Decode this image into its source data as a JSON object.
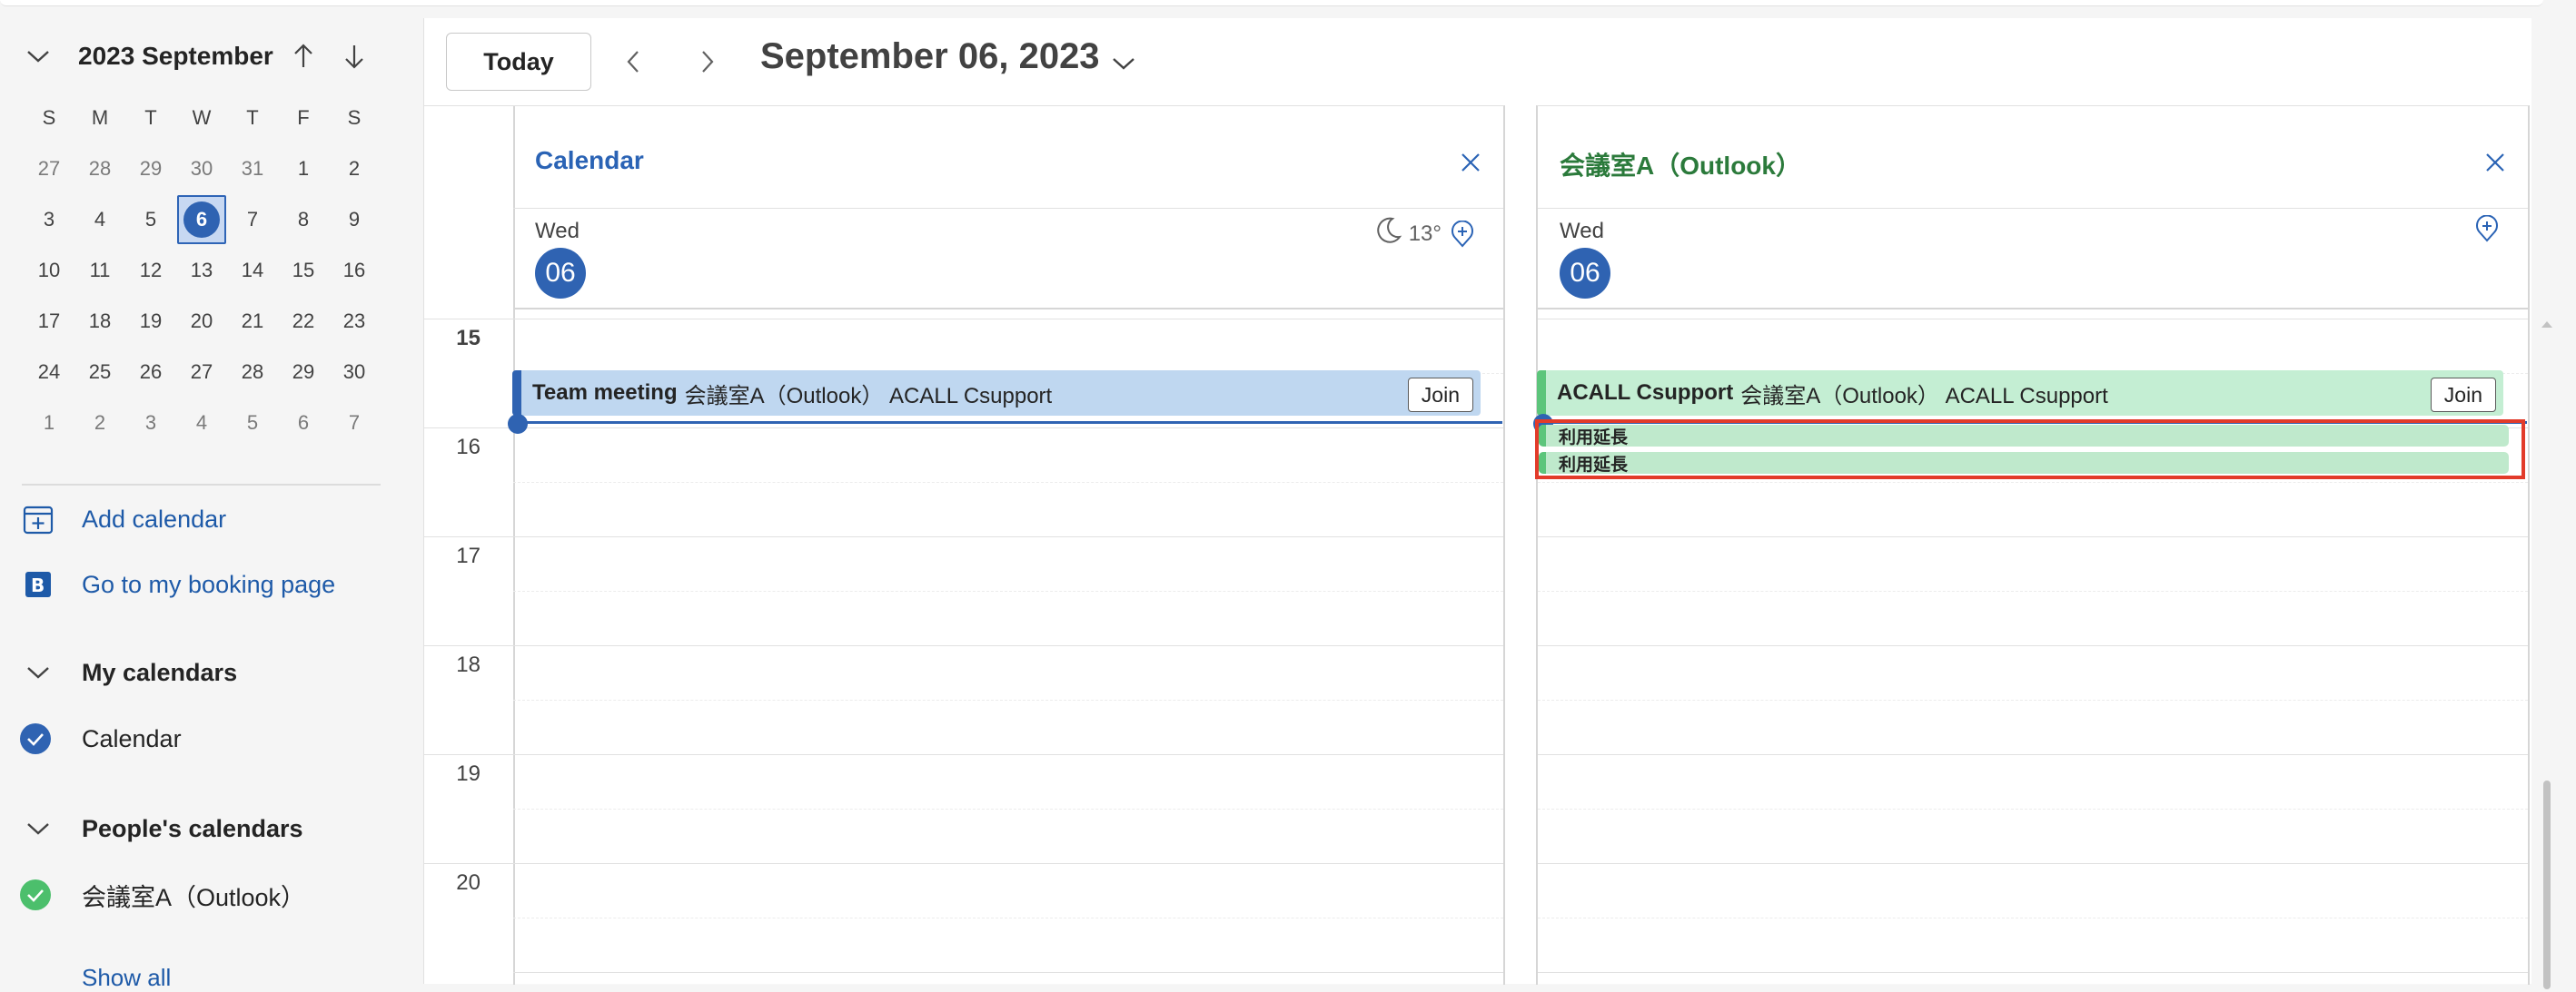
{
  "minical": {
    "month_title": "2023 September",
    "weekdays": [
      "S",
      "M",
      "T",
      "W",
      "T",
      "F",
      "S"
    ],
    "weeks": [
      [
        "27",
        "28",
        "29",
        "30",
        "31",
        "1",
        "2"
      ],
      [
        "3",
        "4",
        "5",
        "6",
        "7",
        "8",
        "9"
      ],
      [
        "10",
        "11",
        "12",
        "13",
        "14",
        "15",
        "16"
      ],
      [
        "17",
        "18",
        "19",
        "20",
        "21",
        "22",
        "23"
      ],
      [
        "24",
        "25",
        "26",
        "27",
        "28",
        "29",
        "30"
      ],
      [
        "1",
        "2",
        "3",
        "4",
        "5",
        "6",
        "7"
      ]
    ],
    "selected_day": "6"
  },
  "sidebar": {
    "add_calendar": "Add calendar",
    "booking_page": "Go to my booking page",
    "my_calendars": "My calendars",
    "my_calendar_item": "Calendar",
    "peoples_calendars": "People's calendars",
    "people_item": "会議室A（Outlook）",
    "show_all": "Show all"
  },
  "toolbar": {
    "today": "Today",
    "date_title": "September 06, 2023"
  },
  "times": [
    "15",
    "16",
    "17",
    "18",
    "19",
    "20"
  ],
  "columns": [
    {
      "title": "Calendar",
      "day_label": "Wed",
      "day_num": "06",
      "weather": "13°",
      "event": {
        "title": "Team meeting",
        "location": "会議室A（Outlook） ACALL Csupport",
        "join": "Join"
      }
    },
    {
      "title": "会議室A（Outlook）",
      "day_label": "Wed",
      "day_num": "06",
      "event": {
        "title": "ACALL Csupport",
        "location": "会議室A（Outlook） ACALL Csupport",
        "join": "Join"
      },
      "mini_events": [
        "利用延長",
        "利用延長"
      ]
    }
  ],
  "colors": {
    "accent": "#2f63b2",
    "calendar_blue": "#bfd7f0",
    "room_green": "#c4eed3",
    "highlight": "#e23b2a"
  }
}
